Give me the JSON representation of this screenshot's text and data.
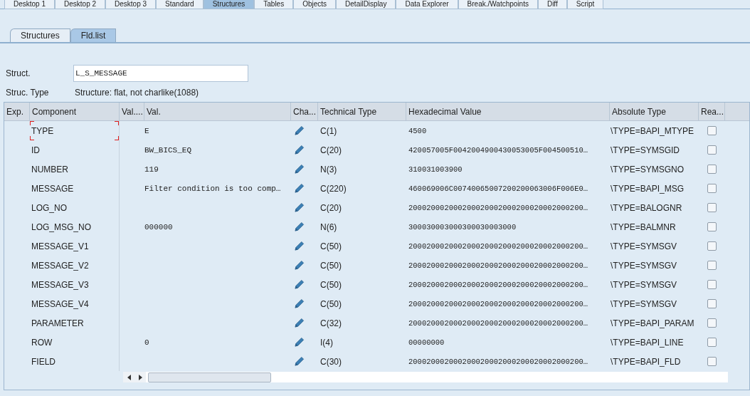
{
  "top_tabs": [
    {
      "label": "Desktop 1",
      "selected": false
    },
    {
      "label": "Desktop 2",
      "selected": false
    },
    {
      "label": "Desktop 3",
      "selected": false
    },
    {
      "label": "Standard",
      "selected": false
    },
    {
      "label": "Structures",
      "selected": true
    },
    {
      "label": "Tables",
      "selected": false
    },
    {
      "label": "Objects",
      "selected": false
    },
    {
      "label": "DetailDisplay",
      "selected": false
    },
    {
      "label": "Data Explorer",
      "selected": false
    },
    {
      "label": "Break./Watchpoints",
      "selected": false
    },
    {
      "label": "Diff",
      "selected": false
    },
    {
      "label": "Script",
      "selected": false
    }
  ],
  "sub_tabs": [
    {
      "label": "Structures",
      "selected": false
    },
    {
      "label": "Fld.list",
      "selected": true
    }
  ],
  "struct": {
    "label": "Struct.",
    "value": "L_S_MESSAGE"
  },
  "struc_type": {
    "label": "Struc. Type",
    "value": "Structure: flat, not charlike(1088)"
  },
  "table": {
    "columns": [
      "Exp.",
      "Component",
      "Val....",
      "Val.",
      "Cha...",
      "Technical Type",
      "Hexadecimal Value",
      "Absolute Type",
      "Rea..."
    ],
    "rows": [
      {
        "component": "TYPE",
        "value": "E",
        "technical_type": "C(1)",
        "hex": "4500",
        "absolute_type": "\\TYPE=BAPI_MTYPE",
        "read_only": false,
        "focused": true
      },
      {
        "component": "ID",
        "value": "BW_BICS_EQ",
        "technical_type": "C(20)",
        "hex": "420057005F0042004900430053005F004500510…",
        "absolute_type": "\\TYPE=SYMSGID",
        "read_only": false,
        "focused": false
      },
      {
        "component": "NUMBER",
        "value": "119",
        "technical_type": "N(3)",
        "hex": "310031003900",
        "absolute_type": "\\TYPE=SYMSGNO",
        "read_only": false,
        "focused": false
      },
      {
        "component": "MESSAGE",
        "value": "Filter condition is too comp…",
        "technical_type": "C(220)",
        "hex": "460069006C00740065007200200063006F006E0…",
        "absolute_type": "\\TYPE=BAPI_MSG",
        "read_only": false,
        "focused": false
      },
      {
        "component": "LOG_NO",
        "value": "",
        "technical_type": "C(20)",
        "hex": "200020002000200020002000200020002000200…",
        "absolute_type": "\\TYPE=BALOGNR",
        "read_only": false,
        "focused": false
      },
      {
        "component": "LOG_MSG_NO",
        "value": "000000",
        "technical_type": "N(6)",
        "hex": "300030003000300030003000",
        "absolute_type": "\\TYPE=BALMNR",
        "read_only": false,
        "focused": false
      },
      {
        "component": "MESSAGE_V1",
        "value": "",
        "technical_type": "C(50)",
        "hex": "200020002000200020002000200020002000200…",
        "absolute_type": "\\TYPE=SYMSGV",
        "read_only": false,
        "focused": false
      },
      {
        "component": "MESSAGE_V2",
        "value": "",
        "technical_type": "C(50)",
        "hex": "200020002000200020002000200020002000200…",
        "absolute_type": "\\TYPE=SYMSGV",
        "read_only": false,
        "focused": false
      },
      {
        "component": "MESSAGE_V3",
        "value": "",
        "technical_type": "C(50)",
        "hex": "200020002000200020002000200020002000200…",
        "absolute_type": "\\TYPE=SYMSGV",
        "read_only": false,
        "focused": false
      },
      {
        "component": "MESSAGE_V4",
        "value": "",
        "technical_type": "C(50)",
        "hex": "200020002000200020002000200020002000200…",
        "absolute_type": "\\TYPE=SYMSGV",
        "read_only": false,
        "focused": false
      },
      {
        "component": "PARAMETER",
        "value": "",
        "technical_type": "C(32)",
        "hex": "200020002000200020002000200020002000200…",
        "absolute_type": "\\TYPE=BAPI_PARAM",
        "read_only": false,
        "focused": false
      },
      {
        "component": "ROW",
        "value": "0",
        "technical_type": "I(4)",
        "hex": "00000000",
        "absolute_type": "\\TYPE=BAPI_LINE",
        "read_only": false,
        "focused": false
      },
      {
        "component": "FIELD",
        "value": "",
        "technical_type": "C(30)",
        "hex": "200020002000200020002000200020002000200…",
        "absolute_type": "\\TYPE=BAPI_FLD",
        "read_only": false,
        "focused": false
      }
    ]
  }
}
